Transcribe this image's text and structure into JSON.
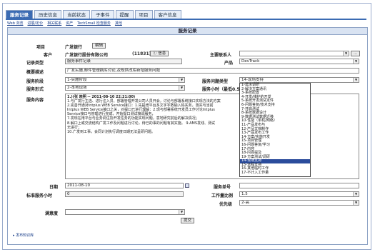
{
  "tabs": [
    "服务记录",
    "历史信息",
    "当前状态",
    "子事件",
    "提醒",
    "项目",
    "客户信息"
  ],
  "subnav": [
    "Web 浏览",
    "进展/定价",
    "相关联系",
    "资产",
    "TechSmall 检查服务",
    "其他"
  ],
  "panel_title": "服务记录",
  "fields": {
    "project_label": "项目",
    "project_value": "广发银行",
    "edit_button": "编辑",
    "customer_label": "客户",
    "customer_value": "广发银行股份有限公司",
    "customer_id": "(11831)",
    "info_button": "信息",
    "contact_label": "主要联系人",
    "contact_dots": "...",
    "record_type_label": "记录类型",
    "record_type_value": "服务事件记录",
    "product_label": "产品",
    "product_value": "DevTrack",
    "summary_label": "概要描述",
    "summary_value": "广发实施,邮件管理摘库讨论,及规供改库新增服务问题",
    "stage_label": "服务阶段",
    "stage_value": "1-实施阶段",
    "issue_type_label": "服务问题类型",
    "issue_type_value": "14-现场支持",
    "form_label": "服务形式",
    "form_value": "2-本地现场",
    "hours_label": "服务小时（最低0.5小时）",
    "content_label": "服务内容",
    "content_lines": [
      "1.)(张 晓明 -- 2011-08-10 22:21:00)",
      "1.与广发行主选、进行注入员、部署管理开发公司人员开会，讨论与部署系统接口实现方法的方案",
      "2.完善开通对Intplus WEB Service接口：1.先提增平台多文字字数输入码实务，落实与当前",
      "Intplus WEB Service接口之关，对提口已进行理解：2.现与部署系统开发员工作讨论Intplus",
      "Service接口与管理进行完成，开始提口测试接调服务，",
      "7.发现在用平台与业务调注协开发任务的功能实现问题，意地研究前后的解决情况；",
      "8.解口上或交流结构广发工作及问题进行讨论，待已的事的问题有其实施。  9.AMS发线、测试",
      "无进行；",
      "10.广发到工事，会同计划执行调度日期无法呈研问题。"
    ],
    "date_label": "日期",
    "date_value": "2011-08-10",
    "service_no_label": "服务单号",
    "std_hours_label": "标准服务小时",
    "std_hours_value": "0",
    "ratio_label": "工作量比例",
    "ratio_value": "1.5",
    "priority_label": "优先级",
    "priority_value": "2-高",
    "satisfaction_label": "满意度",
    "submit_button": "提交",
    "footer_link": "▸ 发布知识库"
  },
  "issue_options": [
    "1-需求调研",
    "2-解决方案通讯",
    "3-系统配置",
    "4-开发/维护的开发",
    "5-系统开发测试定件",
    "6-问题答复/技术支持",
    "7-开启测试",
    "8-系统数据设计",
    "9-数据测试数据迁移",
    "10-性能（单机/网络）",
    "11-产品发布与",
    "12-产品文档制作",
    "13-产品发布工作",
    "14-方案/实施开发",
    "15-项目管理",
    "16-问题答复/学习",
    "17-内容",
    "18-内容提及",
    "19-方案测试/调研",
    "14-现场支持",
    "15-远程支持",
    "16-其他临时工作",
    "17-不计入工作量"
  ],
  "issue_selected_index": 19
}
